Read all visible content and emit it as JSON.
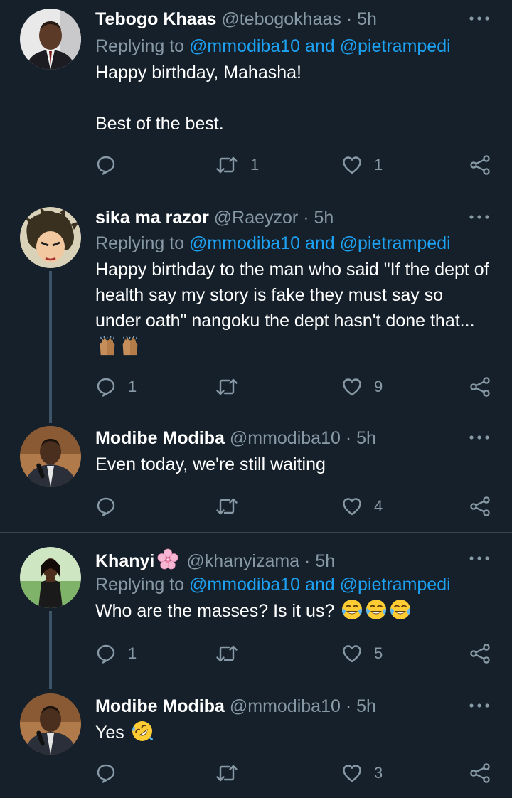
{
  "tweets": [
    {
      "name": "Tebogo Khaas",
      "handle": "@tebogokhaas",
      "time": "5h",
      "replying_prefix": "Replying to ",
      "replying_user1": "@mmodiba10",
      "replying_and": " and ",
      "replying_user2": "@pietrampedi",
      "text": "Happy birthday, Mahasha!\n\nBest of the best.",
      "reply_count": "",
      "retweet_count": "1",
      "like_count": "1"
    },
    {
      "name": "sika ma razor",
      "handle": "@Raeyzor",
      "time": "5h",
      "replying_prefix": "Replying to ",
      "replying_user1": "@mmodiba10",
      "replying_and": " and ",
      "replying_user2": "@pietrampedi",
      "text": "Happy birthday to the man who said \"If the dept of health say my story is fake they must say so under oath\" nangoku the dept hasn't done that...",
      "emoji": "raising-hands-emoji x2",
      "reply_count": "1",
      "retweet_count": "",
      "like_count": "9"
    },
    {
      "name": "Modibe Modiba",
      "handle": "@mmodiba10",
      "time": "5h",
      "text": "Even today, we're still waiting",
      "reply_count": "",
      "retweet_count": "",
      "like_count": "4"
    },
    {
      "name": "Khanyi",
      "name_emoji": "cherry-blossom-emoji",
      "handle": "@khanyizama",
      "time": "5h",
      "replying_prefix": "Replying to ",
      "replying_user1": "@mmodiba10",
      "replying_and": " and ",
      "replying_user2": "@pietrampedi",
      "text": "Who are the masses? Is it us?",
      "emoji": "tears-of-joy-emoji x3",
      "reply_count": "1",
      "retweet_count": "",
      "like_count": "5"
    },
    {
      "name": "Modibe Modiba",
      "handle": "@mmodiba10",
      "time": "5h",
      "text": "Yes",
      "emoji": "rolling-on-floor-laughing-emoji",
      "reply_count": "",
      "retweet_count": "",
      "like_count": "3"
    }
  ],
  "separator": "·",
  "icons": {
    "reply": "reply-icon",
    "retweet": "retweet-icon",
    "like": "heart-icon",
    "share": "share-icon",
    "more": "more-icon"
  },
  "colors": {
    "background": "#15202b",
    "text": "#ffffff",
    "secondary": "#8899a6",
    "link": "#1da1f2",
    "divider": "#38444d",
    "thread_line": "#3d5466"
  }
}
